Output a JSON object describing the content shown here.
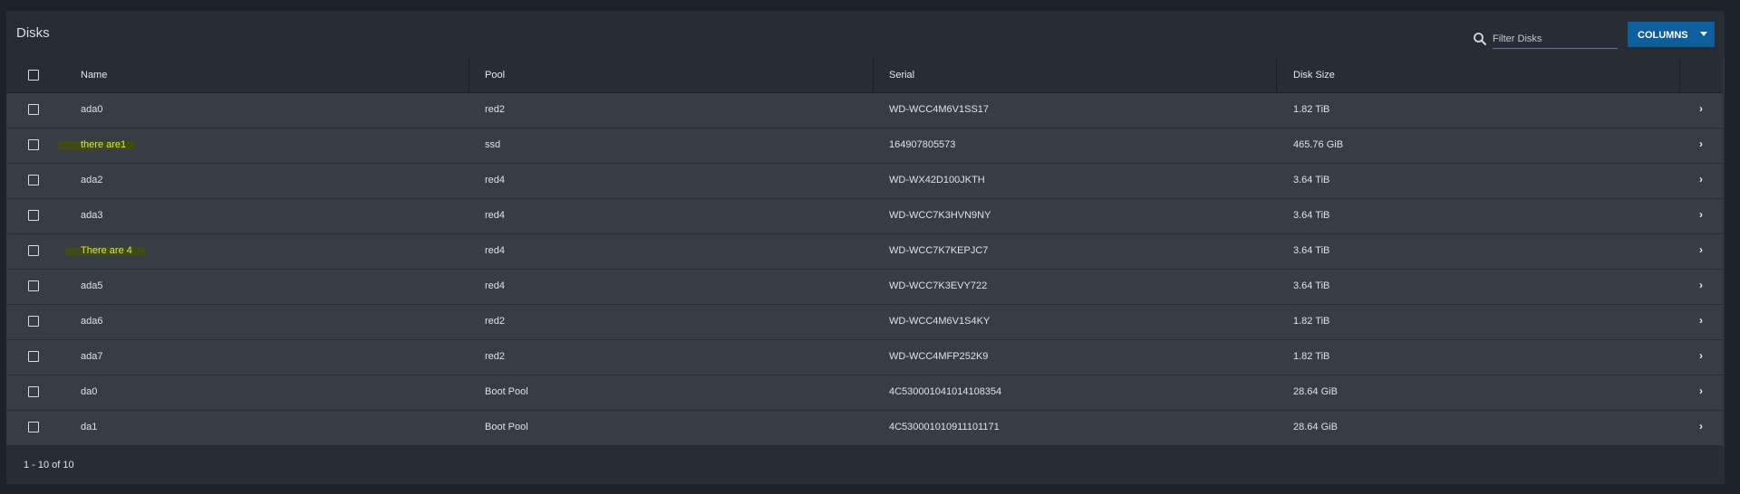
{
  "card": {
    "title": "Disks"
  },
  "search": {
    "placeholder": "Filter Disks",
    "value": ""
  },
  "toolbar": {
    "columns_label": "COLUMNS"
  },
  "table": {
    "headers": {
      "name": "Name",
      "pool": "Pool",
      "serial": "Serial",
      "disk_size": "Disk Size"
    },
    "rows": [
      {
        "name": "ada0",
        "pool": "red2",
        "serial": "WD-WCC4M6V1SS17",
        "size": "1.82 TiB"
      },
      {
        "name": "there are1",
        "pool": "ssd",
        "serial": "164907805573",
        "size": "465.76 GiB",
        "highlighted": true
      },
      {
        "name": "ada2",
        "pool": "red4",
        "serial": "WD-WX42D100JKTH",
        "size": "3.64 TiB"
      },
      {
        "name": "ada3",
        "pool": "red4",
        "serial": "WD-WCC7K3HVN9NY",
        "size": "3.64 TiB"
      },
      {
        "name": "There are 4",
        "pool": "red4",
        "serial": "WD-WCC7K7KEPJC7",
        "size": "3.64 TiB",
        "highlighted": true
      },
      {
        "name": "ada5",
        "pool": "red4",
        "serial": "WD-WCC7K3EVY722",
        "size": "3.64 TiB"
      },
      {
        "name": "ada6",
        "pool": "red2",
        "serial": "WD-WCC4M6V1S4KY",
        "size": "1.82 TiB"
      },
      {
        "name": "ada7",
        "pool": "red2",
        "serial": "WD-WCC4MFP252K9",
        "size": "1.82 TiB"
      },
      {
        "name": "da0",
        "pool": "Boot Pool",
        "serial": "4C530001041014108354",
        "size": "28.64 GiB"
      },
      {
        "name": "da1",
        "pool": "Boot Pool",
        "serial": "4C530001010911101171",
        "size": "28.64 GiB"
      }
    ]
  },
  "pagination": {
    "range_text": "1 - 10 of 10"
  },
  "icons": {
    "search": "search-icon",
    "dropdown": "caret-down-icon",
    "row_expand": "chevron-right-icon"
  },
  "colors": {
    "accent": "#0f5e9c",
    "highlight": "#3f4a16",
    "highlight_text": "#d7e35a"
  }
}
